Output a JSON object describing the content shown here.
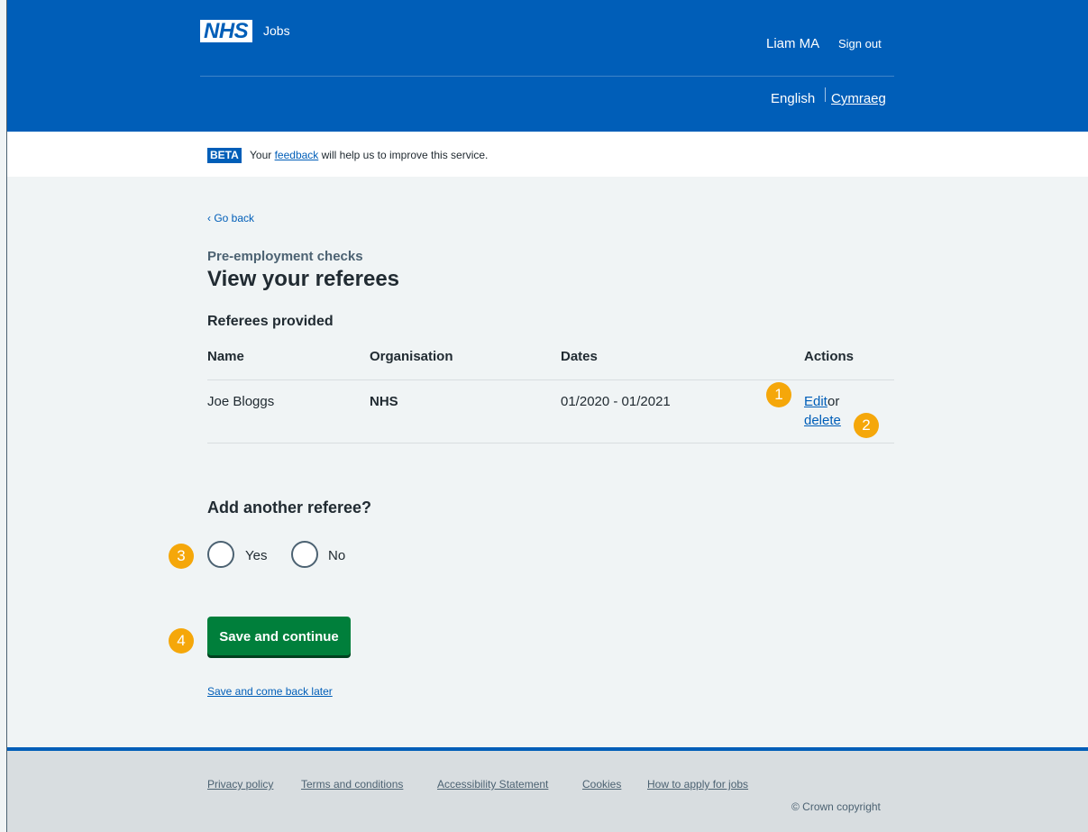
{
  "header": {
    "logo_text": "NHS",
    "service_name": "Jobs",
    "user_name": "Liam MA",
    "sign_out": "Sign out",
    "language_current": "English",
    "language_alt": "Cymraeg",
    "brand_color": "#005eb8"
  },
  "beta": {
    "tag": "BETA",
    "text_before": "Your",
    "link": "feedback",
    "text_after": "will help us to improve this service."
  },
  "main": {
    "back_link": "Go back",
    "caption": "Pre-employment checks",
    "title": "View your referees",
    "table": {
      "caption": "Referees provided",
      "headers": [
        "Name",
        "Organisation",
        "Dates",
        "Actions"
      ],
      "rows": [
        {
          "name": "Joe Bloggs",
          "organisation": "NHS",
          "dates": "01/2020 - 01/2021",
          "edit": "Edit",
          "or": "or",
          "delete": "delete"
        }
      ]
    },
    "question": "Add another referee?",
    "options": [
      "Yes",
      "No"
    ],
    "primary_button": "Save and continue",
    "secondary_link": "Save and come back later"
  },
  "markers": [
    "1",
    "2",
    "3",
    "4"
  ],
  "footer": {
    "links": [
      "Privacy policy",
      "Terms and conditions",
      "Accessibility Statement",
      "Cookies",
      "How to apply for jobs"
    ],
    "copyright": "© Crown copyright"
  }
}
